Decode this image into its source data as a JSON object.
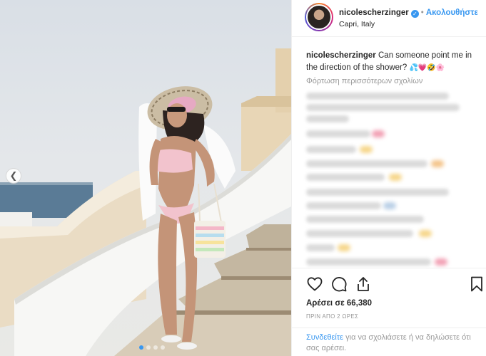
{
  "post": {
    "username": "nicolescherzinger",
    "verified": true,
    "separator": "•",
    "follow_label": "Ακολουθήστε",
    "location": "Capri, Italy",
    "caption_user": "nicolescherzinger",
    "caption_text": "Can someone point me in the direction of the shower?",
    "caption_emojis": "💦💗🤣🌸",
    "load_more_label": "Φόρτωση περισσότερων σχολίων",
    "likes_label": "Αρέσει σε 66,380",
    "time_label": "ΠΡΙΝ ΑΠΟ 2 ΩΡΕΣ",
    "login_link": "Συνδεθείτε",
    "login_text": " για να σχολιάσετε ή να δηλώσετε ότι σας αρέσει."
  },
  "icons": {
    "like": "heart-icon",
    "comment": "comment-icon",
    "share": "share-icon",
    "save": "bookmark-icon",
    "verified": "verified-badge-icon",
    "carousel_prev": "chevron-left-icon"
  },
  "carousel": {
    "count": 4,
    "active_index": 0
  },
  "colors": {
    "accent": "#3897f0",
    "text": "#262626",
    "muted": "#999999",
    "border": "#efefef"
  }
}
